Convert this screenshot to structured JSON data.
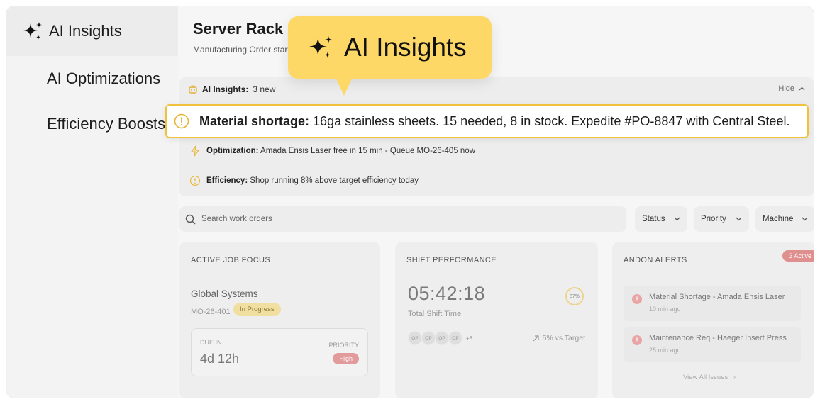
{
  "sidebar": {
    "items": [
      {
        "label": "AI Insights",
        "icon": "sparkles-icon"
      },
      {
        "label": "AI Optimizations"
      },
      {
        "label": "Efficiency Boosts"
      }
    ]
  },
  "header": {
    "title": "Server Rack C",
    "subtitle": "Manufacturing Order starte"
  },
  "insights": {
    "label": "AI Insights:",
    "count_text": "3 new",
    "hide_label": "Hide",
    "items": [
      {
        "type": "Material shortage:",
        "text": "16ga stainless sheets. 15 needed, 8 in stock. Expedite #PO-8847 with Central Steel.",
        "icon": "warning-icon"
      },
      {
        "type": "Optimization:",
        "text": "Amada Ensis Laser free in 15 min - Queue MO-26-405 now",
        "icon": "lightning-icon"
      },
      {
        "type": "Efficiency:",
        "text": "Shop running 8% above target efficiency today",
        "icon": "info-icon"
      }
    ]
  },
  "tooltip": {
    "label": "AI Insights",
    "icon": "sparkles-icon"
  },
  "search": {
    "placeholder": "Search work orders"
  },
  "filters": {
    "status": "Status",
    "priority": "Priority",
    "machine": "Machine"
  },
  "active_job": {
    "title": "ACTIVE JOB FOCUS",
    "customer": "Global Systems",
    "order_id": "MO-26-401",
    "status": "In Progress",
    "due_label": "DUE IN",
    "due_value": "4d 12h",
    "priority_label": "PRIORITY",
    "priority_value": "High"
  },
  "shift": {
    "title": "SHIFT PERFORMANCE",
    "timer": "05:42:18",
    "timer_label": "Total Shift Time",
    "percent": "87%",
    "avatars": [
      "OP",
      "OP",
      "OP",
      "OP"
    ],
    "more": "+8",
    "vs_target": "5% vs Target"
  },
  "andon": {
    "title": "ANDON ALERTS",
    "badge": "3 Active",
    "alerts": [
      {
        "title": "Material Shortage - Amada Ensis Laser",
        "time": "10 min ago"
      },
      {
        "title": "Maintenance Req - Haeger Insert Press",
        "time": "25 min ago"
      }
    ],
    "view_all": "View All Issues"
  },
  "colors": {
    "accent": "#fed866",
    "highlight_border": "#f0c23c",
    "alert": "#e08f8f"
  }
}
